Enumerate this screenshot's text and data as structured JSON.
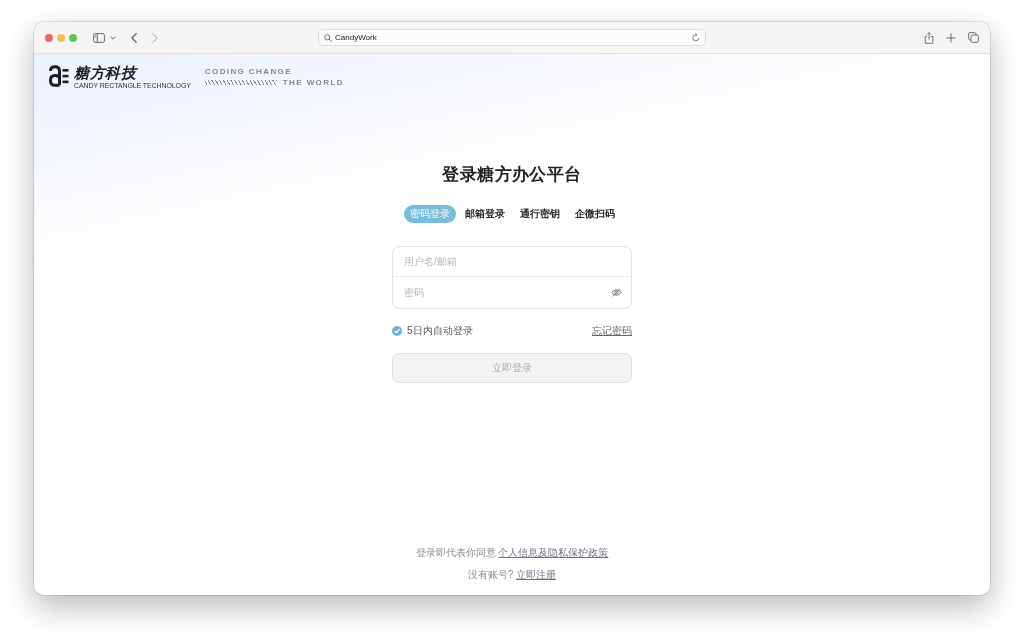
{
  "browser": {
    "address": "CandyWork",
    "back_disabled": false,
    "forward_disabled": true
  },
  "brand": {
    "name": "糖方科技",
    "subtitle": "CANDY RECTANGLE TECHNOLOGY",
    "slogan_line_1": "CODING CHANGE",
    "slogan_line_2": "THE WORLD"
  },
  "login": {
    "title": "登录糖方办公平台",
    "tabs": [
      {
        "label": "密码登录",
        "selected": true
      },
      {
        "label": "邮箱登录",
        "selected": false
      },
      {
        "label": "通行密钥",
        "selected": false
      },
      {
        "label": "企微扫码",
        "selected": false
      }
    ],
    "fields": [
      {
        "kind": "text",
        "placeholder": "用户名/邮箱"
      },
      {
        "kind": "password",
        "placeholder": "密码"
      }
    ],
    "remember": {
      "label": "5日内自动登录",
      "checked": true
    },
    "forgot_link": "忘记密码",
    "submit": {
      "label": "立即登录",
      "disabled": true
    }
  },
  "footer": {
    "agreement": {
      "text": "登录即代表你同意",
      "link": "个人信息及隐私保护政策"
    },
    "signup": {
      "text": "没有账号?",
      "link": "立即注册"
    }
  }
}
